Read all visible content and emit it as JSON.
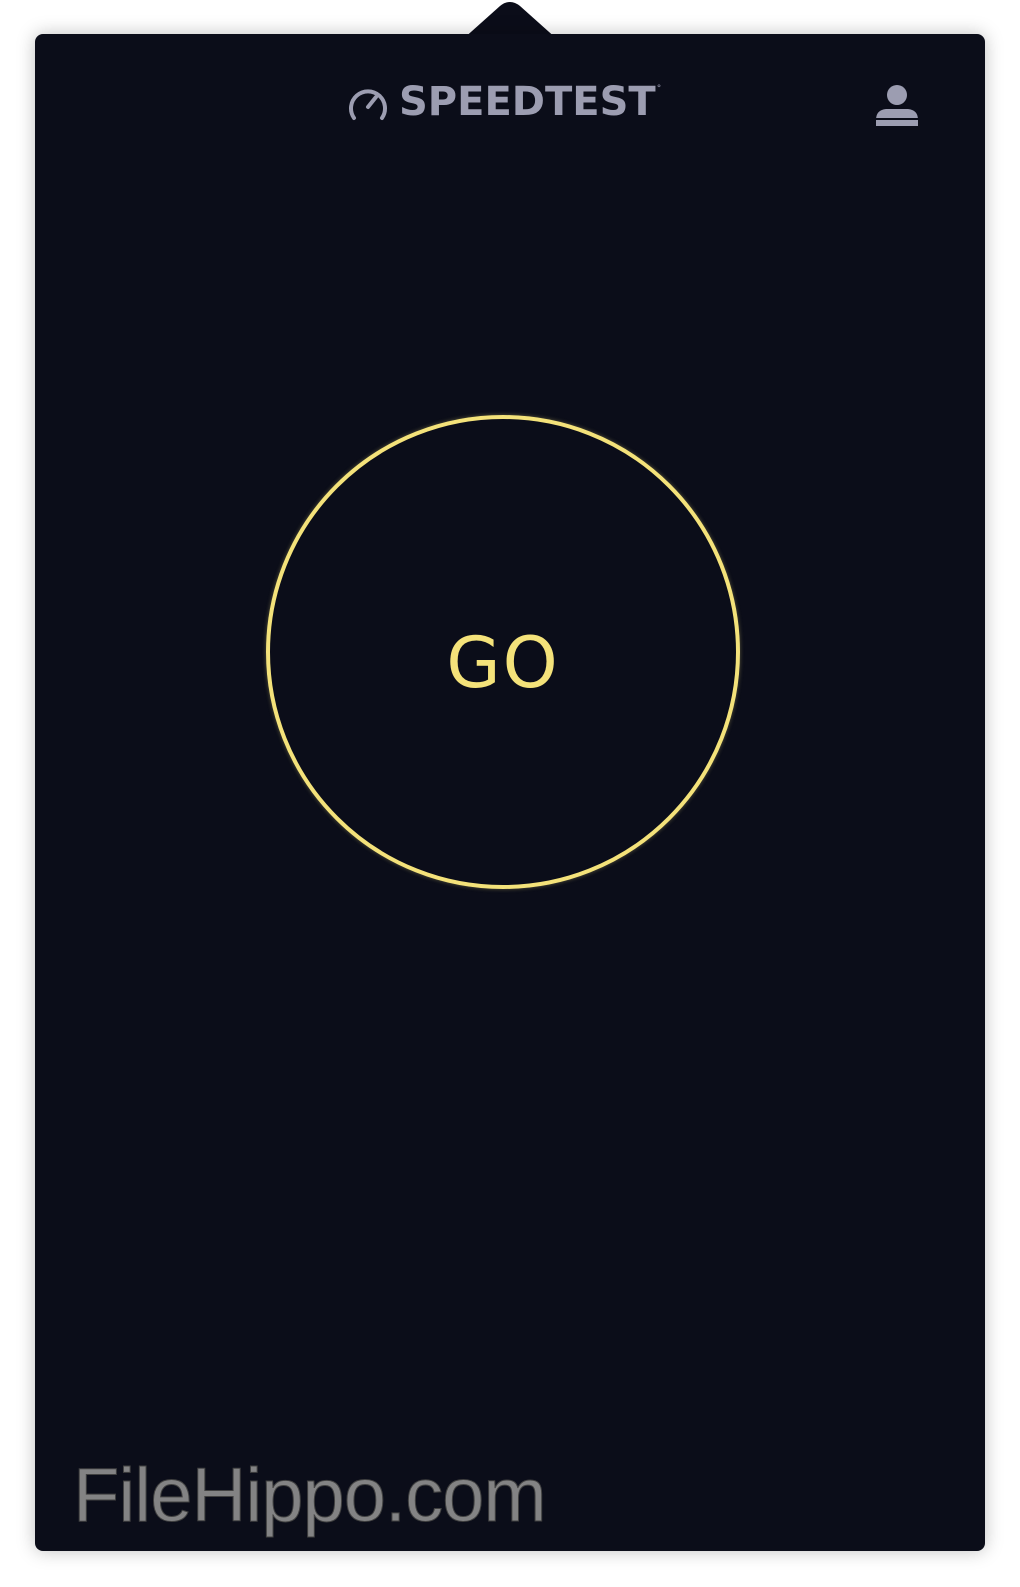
{
  "header": {
    "brand_name": "SPEEDTEST",
    "brand_trademark": "°",
    "brand_icon": "speedometer-icon",
    "account_icon": "user-icon"
  },
  "main": {
    "go_label": "GO"
  },
  "watermark": {
    "text": "FileHippo.com"
  },
  "colors": {
    "background": "#0b0d19",
    "accent": "#f4e27a",
    "muted_text": "#9c9db1",
    "page": "#ffffff"
  }
}
